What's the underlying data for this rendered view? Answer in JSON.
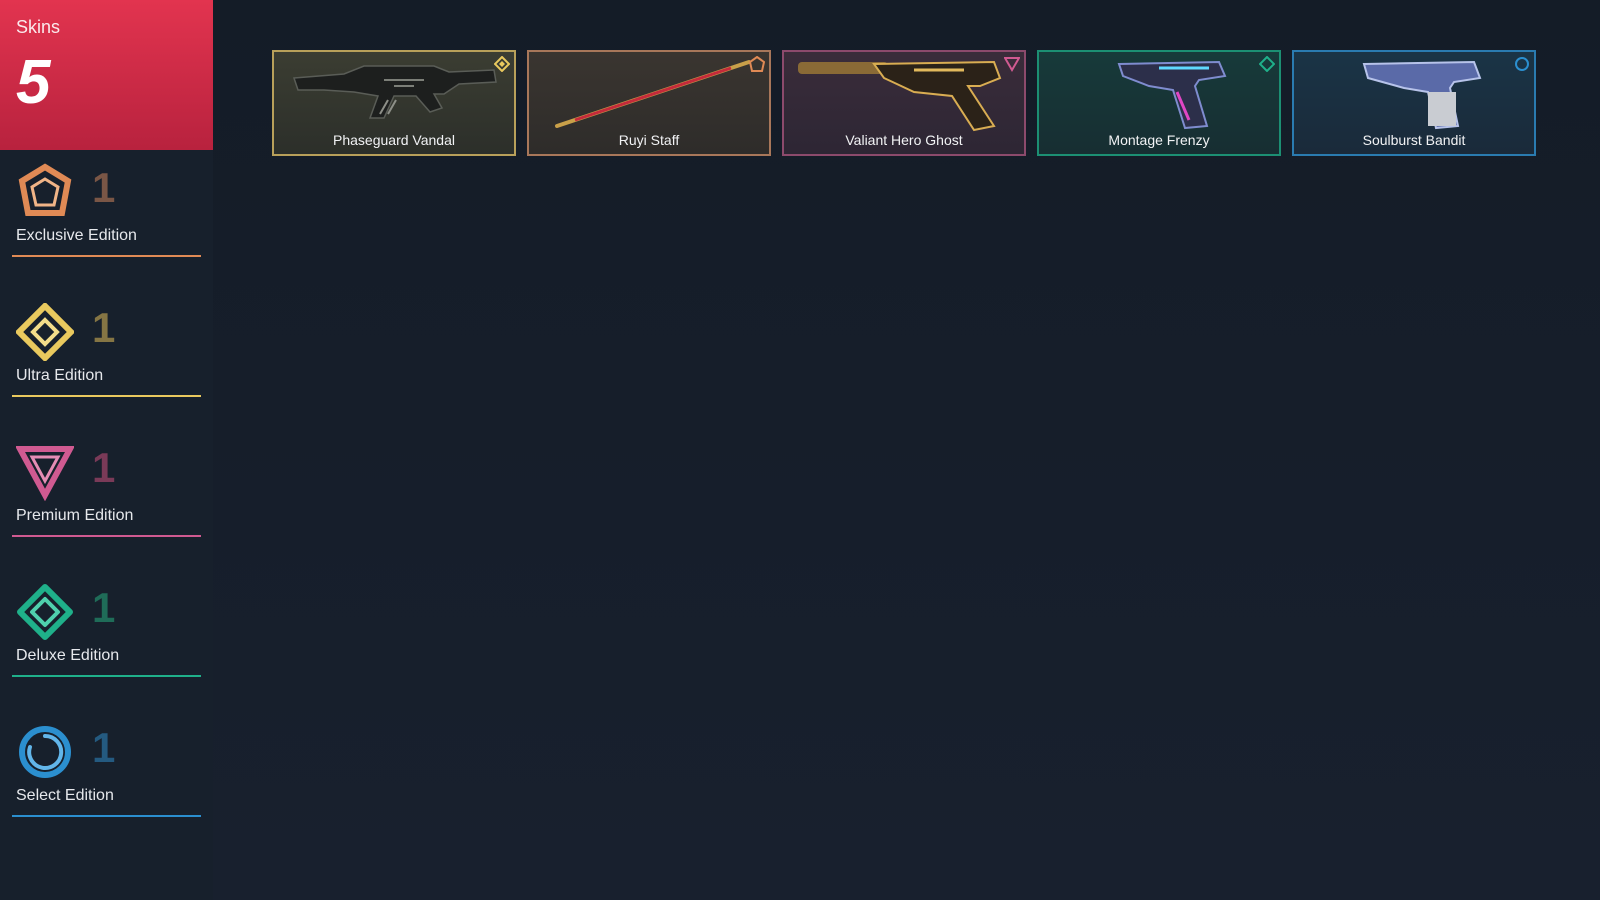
{
  "total": {
    "label": "Skins",
    "count": "5"
  },
  "tiers": [
    {
      "name": "Exclusive Edition",
      "count": "1",
      "icon": "exclusive-tier-icon",
      "color": "#e08a55"
    },
    {
      "name": "Ultra Edition",
      "count": "1",
      "icon": "ultra-tier-icon",
      "color": "#e9c95e"
    },
    {
      "name": "Premium Edition",
      "count": "1",
      "icon": "premium-tier-icon",
      "color": "#d05a91"
    },
    {
      "name": "Deluxe Edition",
      "count": "1",
      "icon": "deluxe-tier-icon",
      "color": "#1fb08a"
    },
    {
      "name": "Select Edition",
      "count": "1",
      "icon": "select-tier-icon",
      "color": "#2b8fcf"
    }
  ],
  "skins": [
    {
      "name": "Phaseguard Vandal",
      "tier": "ultra",
      "icon": "rifle-icon"
    },
    {
      "name": "Ruyi Staff",
      "tier": "exclusive",
      "icon": "staff-icon"
    },
    {
      "name": "Valiant Hero Ghost",
      "tier": "premium",
      "icon": "pistol-icon"
    },
    {
      "name": "Montage Frenzy",
      "tier": "deluxe",
      "icon": "pistol-icon"
    },
    {
      "name": "Soulburst Bandit",
      "tier": "select",
      "icon": "pistol-icon"
    }
  ]
}
